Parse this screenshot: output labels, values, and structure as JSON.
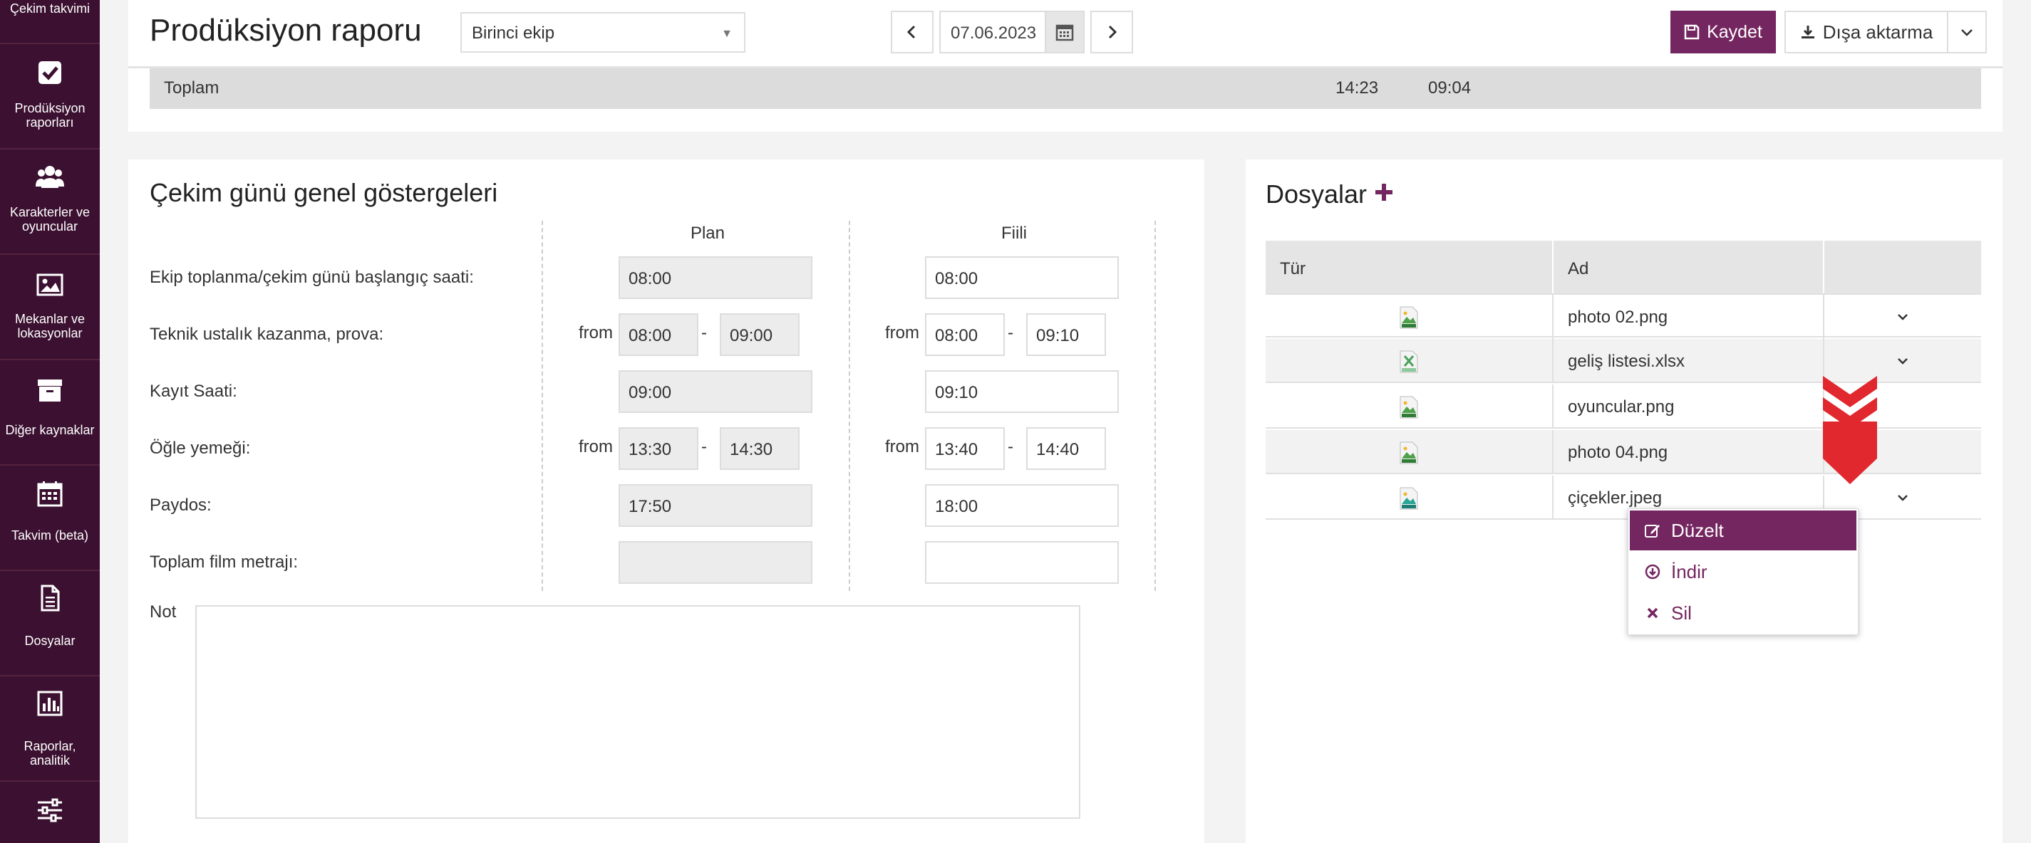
{
  "sidebar": {
    "items": [
      {
        "label": "Çekim takvimi",
        "icon": "calendar-list-icon"
      },
      {
        "label": "Prodüksiyon raporları",
        "icon": "checkbox-icon"
      },
      {
        "label": "Karakterler ve oyuncular",
        "icon": "users-icon"
      },
      {
        "label": "Mekanlar ve lokasyonlar",
        "icon": "image-icon"
      },
      {
        "label": "Diğer kaynaklar",
        "icon": "archive-icon"
      },
      {
        "label": "Takvim (beta)",
        "icon": "calendar-icon"
      },
      {
        "label": "Dosyalar",
        "icon": "file-icon"
      },
      {
        "label": "Raporlar, analitik",
        "icon": "bar-chart-icon"
      },
      {
        "label": "",
        "icon": "sliders-icon"
      }
    ]
  },
  "header": {
    "title": "Prodüksiyon raporu",
    "crew_select": "Birinci ekip",
    "date": "07.06.2023",
    "save_label": "Kaydet",
    "export_label": "Dışa aktarma"
  },
  "totals": {
    "label": "Toplam",
    "value1": "14:23",
    "value2": "09:04"
  },
  "indicators": {
    "title": "Çekim günü genel göstergeleri",
    "plan_header": "Plan",
    "actual_header": "Fiili",
    "from_label": "from",
    "dash": "-",
    "rows": [
      {
        "label": "Ekip toplanma/çekim günü başlangıç saati:",
        "plan": "08:00",
        "actual": "08:00"
      },
      {
        "label": "Teknik ustalık kazanma, prova:",
        "plan_from": "08:00",
        "plan_to": "09:00",
        "actual_from": "08:00",
        "actual_to": "09:10"
      },
      {
        "label": "Kayıt Saati:",
        "plan": "09:00",
        "actual": "09:10"
      },
      {
        "label": "Öğle yemeği:",
        "plan_from": "13:30",
        "plan_to": "14:30",
        "actual_from": "13:40",
        "actual_to": "14:40"
      },
      {
        "label": "Paydos:",
        "plan": "17:50",
        "actual": "18:00"
      },
      {
        "label": "Toplam film metrajı:",
        "plan": "",
        "actual": ""
      }
    ],
    "note_label": "Not",
    "note_value": ""
  },
  "files": {
    "title": "Dosyalar",
    "columns": [
      "Tür",
      "Ad",
      ""
    ],
    "rows": [
      {
        "type": "png",
        "name": "photo 02.png"
      },
      {
        "type": "xlsx",
        "name": "geliş listesi.xlsx"
      },
      {
        "type": "png",
        "name": "oyuncular.png"
      },
      {
        "type": "png",
        "name": "photo 04.png"
      },
      {
        "type": "jpeg",
        "name": "çiçekler.jpeg"
      }
    ],
    "context_menu": [
      {
        "label": "Düzelt",
        "icon": "edit-icon"
      },
      {
        "label": "İndir",
        "icon": "download-circle-icon"
      },
      {
        "label": "Sil",
        "icon": "close-icon"
      }
    ]
  },
  "colors": {
    "brand": "#742660",
    "sidebar": "#3b1030",
    "marker": "#e0282e"
  }
}
